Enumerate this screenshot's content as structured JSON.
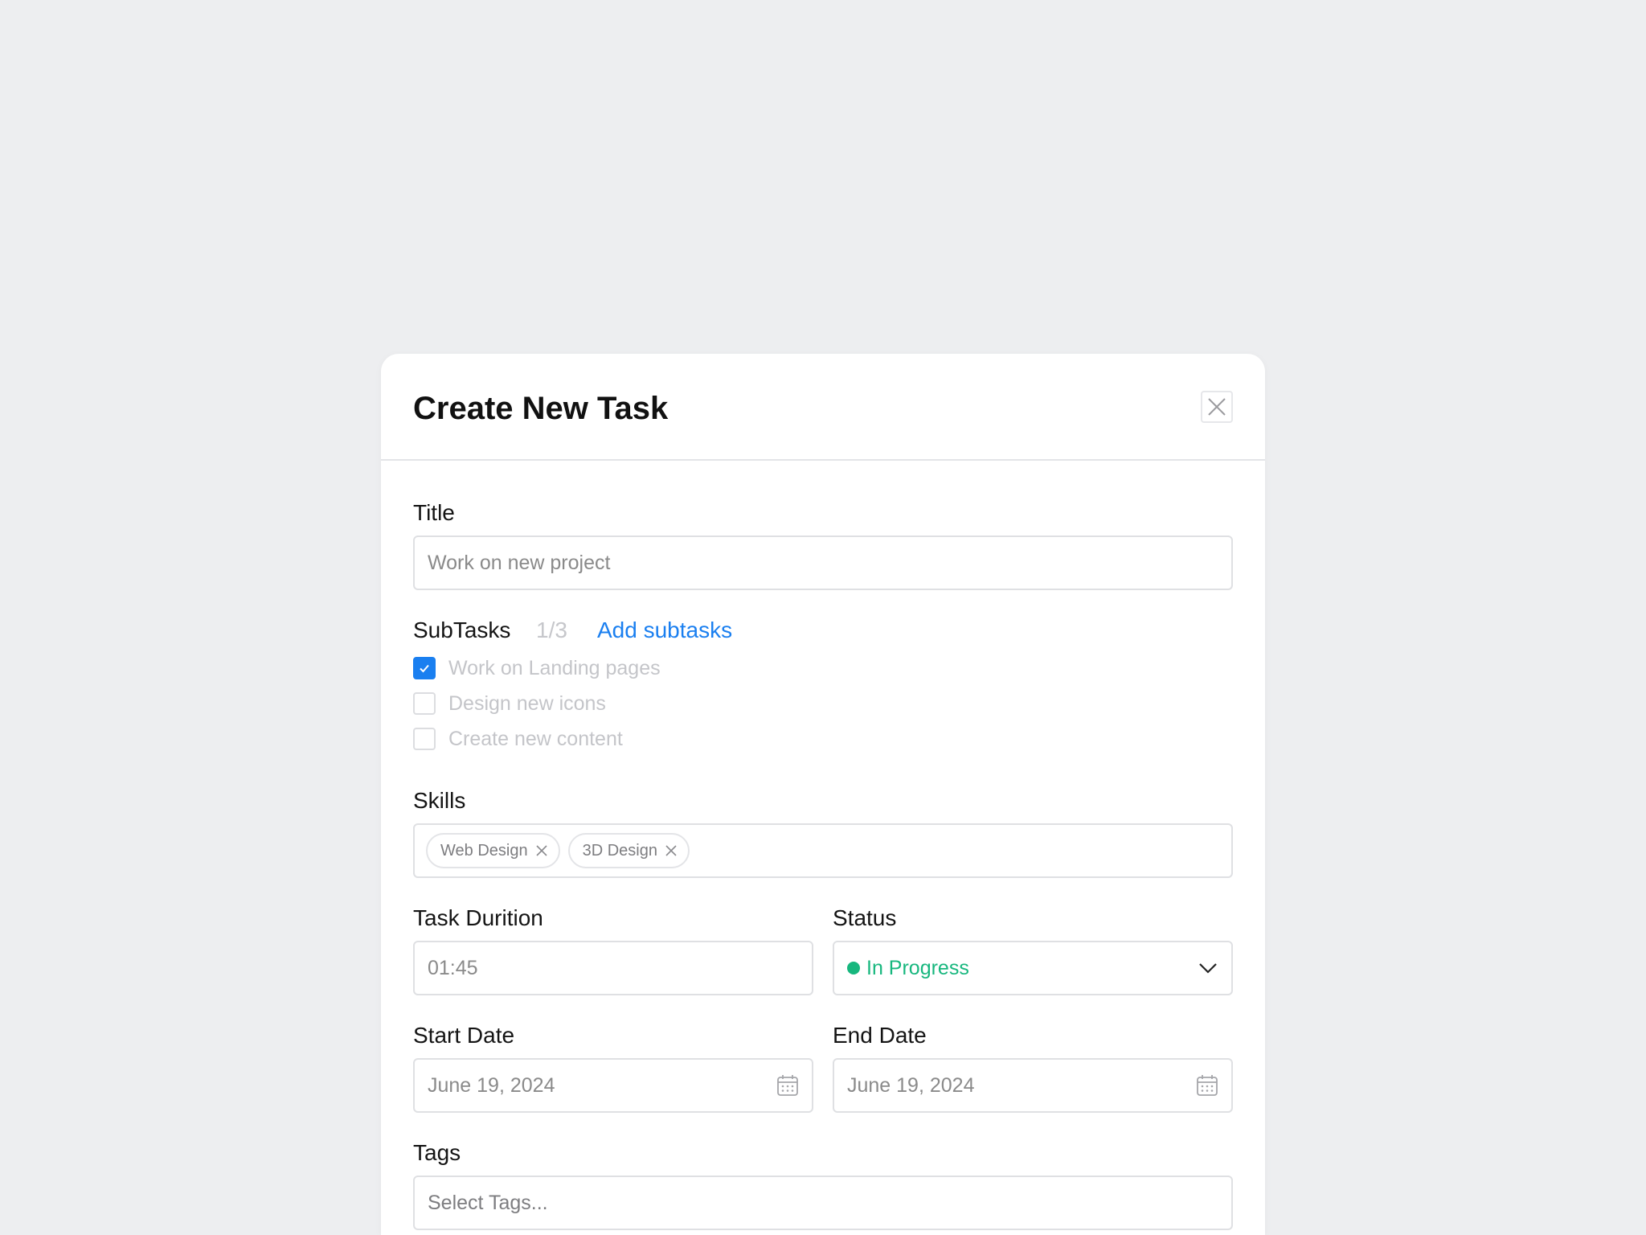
{
  "modal": {
    "title": "Create New Task"
  },
  "title_field": {
    "label": "Title",
    "value": "Work on new project"
  },
  "subtasks": {
    "label": "SubTasks",
    "count": "1/3",
    "add_label": "Add subtasks",
    "items": [
      {
        "label": "Work on Landing pages",
        "checked": true
      },
      {
        "label": "Design new icons",
        "checked": false
      },
      {
        "label": "Create new content",
        "checked": false
      }
    ]
  },
  "skills": {
    "label": "Skills",
    "chips": [
      "Web Design",
      "3D Design"
    ]
  },
  "duration": {
    "label": "Task Durition",
    "value": "01:45"
  },
  "status": {
    "label": "Status",
    "value": "In Progress",
    "color": "#17b77e"
  },
  "start_date": {
    "label": "Start Date",
    "value": "June 19, 2024"
  },
  "end_date": {
    "label": "End Date",
    "value": "June 19, 2024"
  },
  "tags": {
    "label": "Tags",
    "placeholder": "Select Tags..."
  },
  "colors": {
    "accent": "#1a7ff0",
    "status_green": "#17b77e",
    "background": "#edeef0"
  },
  "icons": {
    "close": "close-icon",
    "check": "check-icon",
    "chip_remove": "x-icon",
    "dropdown": "chevron-down-icon",
    "calendar": "calendar-icon"
  }
}
